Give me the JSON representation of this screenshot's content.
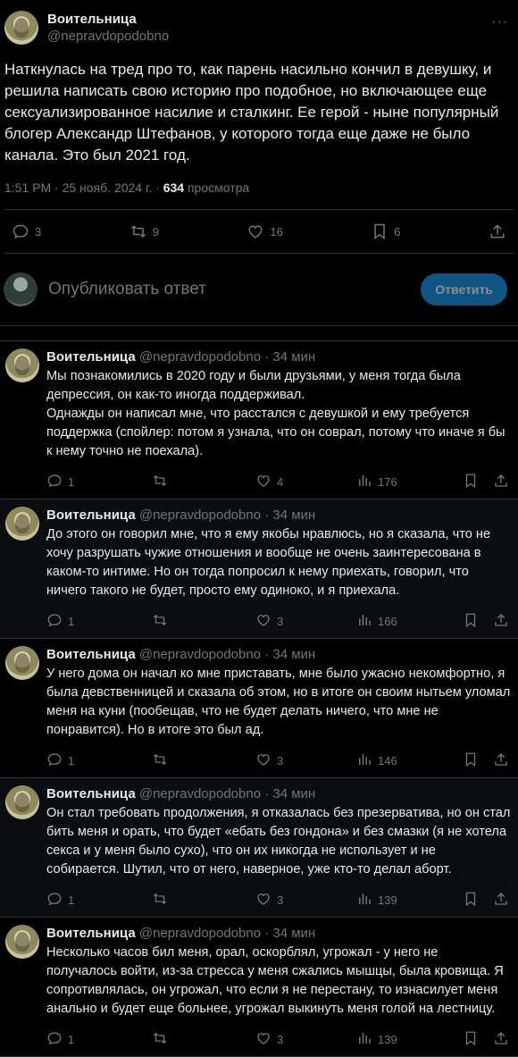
{
  "op": {
    "name": "Воительница",
    "handle": "@nepravdopodobno",
    "more": "···",
    "text": "Наткнулась на тред про то, как парень насильно кончил в девушку, и решила написать свою историю про подобное, но включающее еще сексуализированное насилие и сталкинг. Ее герой - ныне популярный блогер Александр Штефанов, у которого тогда еще даже не было канала. Это был 2021 год.",
    "time": "1:51 PM · 25 нояб. 2024 г. · ",
    "views": "634",
    "views_label": " просмотра",
    "stats": {
      "replies": "3",
      "retweets": "9",
      "likes": "16",
      "bookmarks": "6"
    }
  },
  "reply_box": {
    "placeholder": "Опубликовать ответ",
    "button": "Ответить"
  },
  "replies": [
    {
      "name": "Воительница",
      "handle": "@nepravdopodobno",
      "time": " · 34 мин",
      "text": "Мы познакомились в 2020 году и были друзьями,  у меня тогда была депрессия, он как-то иногда поддерживал.\nОднажды он написал мне, что расстался с девушкой и ему требуется поддержка (спойлер: потом я узнала, что  он соврал, потому что иначе я бы к нему точно не поехала).",
      "replies": "1",
      "retweets": "",
      "likes": "4",
      "views": "176"
    },
    {
      "name": "Воительница",
      "handle": "@nepravdopodobno",
      "time": " · 34 мин",
      "text": "До этого он говорил мне, что я ему якобы нравлюсь, но я сказала, что не хочу разрушать чужие отношения и вообще не очень заинтересована в каком-то интиме. Но он тогда попросил к нему приехать, говорил, что ничего такого не будет, просто ему одиноко, и я приехала.",
      "replies": "1",
      "retweets": "",
      "likes": "3",
      "views": "166"
    },
    {
      "name": "Воительница",
      "handle": "@nepravdopodobno",
      "time": " · 34 мин",
      "text": "У него дома он начал ко мне приставать, мне было ужасно некомфортно, я была девственницей и сказала об этом, но в итоге он своим нытьем уломал меня на куни (пообещав, что не будет делать ничего, что мне не понравится). Но в итоге это был ад.",
      "replies": "1",
      "retweets": "",
      "likes": "3",
      "views": "146"
    },
    {
      "name": "Воительница",
      "handle": "@nepravdopodobno",
      "time": " · 34 мин",
      "text": "Он  стал  требовать продолжения, я отказалась без презерватива, но он стал бить меня и орать, что будет «ебать без гондона» и без смазки (я не хотела секса и у меня было сухо), что он их никогда не использует и не собирается. Шутил, что от него, наверное, уже кто-то делал аборт.",
      "replies": "1",
      "retweets": "",
      "likes": "3",
      "views": "139"
    },
    {
      "name": "Воительница",
      "handle": "@nepravdopodobno",
      "time": " · 34 мин",
      "text": "Несколько часов бил меня, орал, оскорблял, угрожал - у него не получалось войти, из-за стресса у меня сжались мышцы, была кровища. Я сопротивлялась, он угрожал, что если я не перестану, то изнасилует меня анально и будет еще больнее, угрожал выкинуть меня голой на лестницу.",
      "replies": "1",
      "retweets": "",
      "likes": "3",
      "views": "139"
    }
  ]
}
